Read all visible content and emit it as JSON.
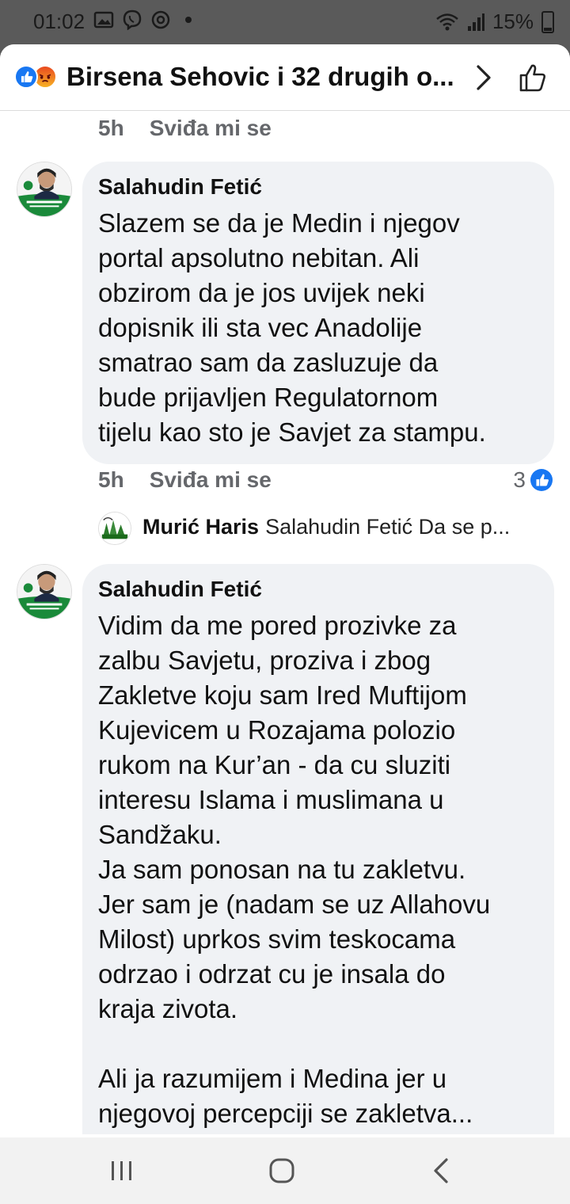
{
  "status_bar": {
    "time": "01:02",
    "battery": "15%",
    "icons": [
      "gallery-icon",
      "viber-icon",
      "messenger-icon",
      "notification-dot",
      "wifi-icon",
      "signal-icon",
      "battery-icon"
    ]
  },
  "header": {
    "title": "Birsena Sehovic i 32 drugih o...",
    "reactions": [
      "like-reaction-icon",
      "angry-reaction-icon"
    ]
  },
  "comments": [
    {
      "time": "5h",
      "like_label": "Sviđa mi se"
    },
    {
      "author": "Salahudin Fetić",
      "body": "Slazem se da je Medin i njegov\nportal apsolutno nebitan. Ali\nobzirom da je jos uvijek neki\ndopisnik ili sta vec Anadolije\nsmatrao sam da zasluzuje da\nbude prijavljen Regulatornom\ntijelu kao sto je Savjet za stampu.",
      "time": "5h",
      "like_label": "Sviđa mi se",
      "reaction_count": "3",
      "reply": {
        "author": "Murić Haris",
        "preview": "Salahudin Fetić Da se p..."
      }
    },
    {
      "author": "Salahudin Fetić",
      "body": "Vidim da me pored prozivke za\nzalbu Savjetu, proziva i zbog\nZakletve koju sam Ired Muftijom\nKujevicem u Rozajama polozio\nrukom na Kur’an - da cu sluziti\ninteresu Islama i muslimana u\nSandžaku.\nJa sam ponosan na tu zakletvu.\nJer sam je (nadam se uz Allahovu\nMilost) uprkos svim teskocama\nodrzao i odrzat cu je insala do\nkraja zivota.\n\nAli ja razumijem i Medina jer u\nnjegovoj percepciji se zakletva..."
    }
  ],
  "colors": {
    "like_blue": "#1877f2",
    "bubble_bg": "#f0f2f5",
    "meta_grey": "#65676b"
  }
}
